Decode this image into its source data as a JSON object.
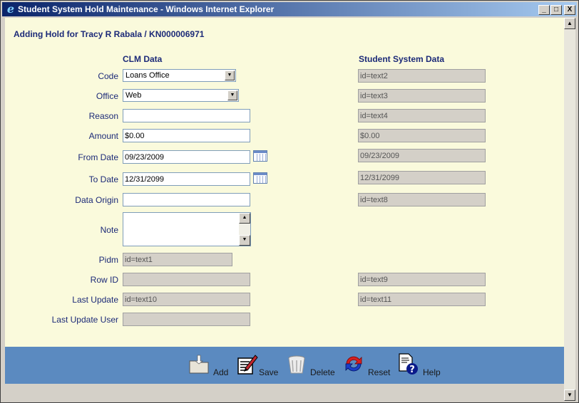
{
  "window": {
    "title": "Student System Hold Maintenance - Windows Internet Explorer",
    "controls": {
      "minimize": "_",
      "maximize": "□",
      "close": "X"
    }
  },
  "page": {
    "heading": "Adding Hold for Tracy R Rabala / KN000006971",
    "clm_header": "CLM Data",
    "student_header": "Student System Data"
  },
  "fields": {
    "code": {
      "label": "Code",
      "value": "Loans Office",
      "student": "id=text2"
    },
    "office": {
      "label": "Office",
      "value": "Web",
      "student": "id=text3"
    },
    "reason": {
      "label": "Reason",
      "value": "",
      "student": "id=text4"
    },
    "amount": {
      "label": "Amount",
      "value": "$0.00",
      "student": "$0.00"
    },
    "from_date": {
      "label": "From Date",
      "value": "09/23/2009",
      "student": "09/23/2009"
    },
    "to_date": {
      "label": "To Date",
      "value": "12/31/2099",
      "student": "12/31/2099"
    },
    "data_origin": {
      "label": "Data Origin",
      "value": "",
      "student": "id=text8"
    },
    "note": {
      "label": "Note",
      "value": ""
    },
    "pidm": {
      "label": "Pidm",
      "value": "id=text1"
    },
    "row_id": {
      "label": "Row ID",
      "value": "",
      "student": "id=text9"
    },
    "last_update": {
      "label": "Last Update",
      "value": "id=text10",
      "student": "id=text11"
    },
    "last_update_user": {
      "label": "Last Update User",
      "value": ""
    }
  },
  "toolbar": {
    "add": "Add",
    "save": "Save",
    "delete": "Delete",
    "reset": "Reset",
    "help": "Help"
  },
  "colors": {
    "page_bg": "#fafadc",
    "label": "#1c2a78",
    "footer_bg": "#5b8ac0",
    "titlebar": "#0a246a"
  }
}
